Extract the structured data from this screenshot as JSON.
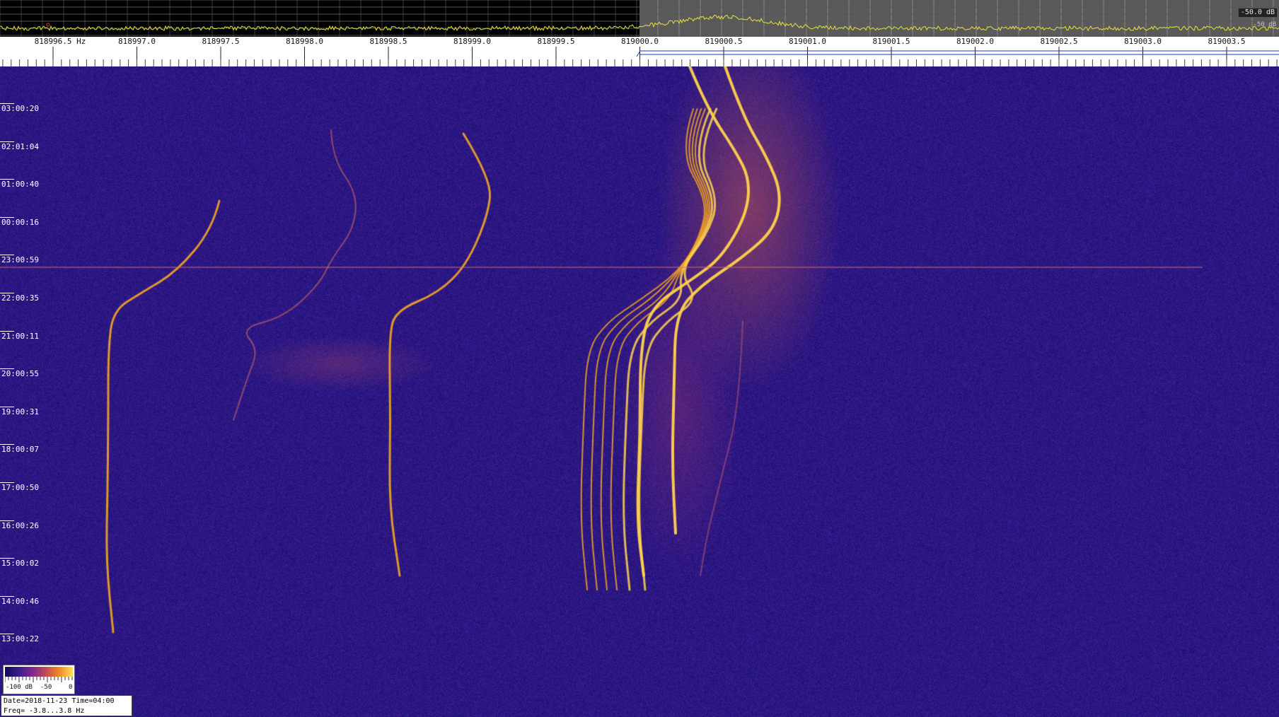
{
  "spectrum": {
    "db_label": "-50.0 dB",
    "db_label_secondary": "-50 dB",
    "trace_color": "#e6e63a",
    "marker_color": "#ff3030"
  },
  "ruler": {
    "freq_labels": [
      "818996.5 Hz",
      "818997.0",
      "818997.5",
      "818998.0",
      "818998.5",
      "818999.0",
      "818999.5",
      "819000.0",
      "819000.5",
      "819001.0",
      "819001.5",
      "819002.0",
      "819002.5",
      "819003.0",
      "819003.5"
    ]
  },
  "waterfall": {
    "time_labels": [
      "03:00:20",
      "02:01:04",
      "01:00:40",
      "00:00:16",
      "23:00:59",
      "22:00:35",
      "21:00:11",
      "20:00:55",
      "19:00:31",
      "18:00:07",
      "17:00:50",
      "16:00:26",
      "15:00:02",
      "14:00:46",
      "13:00:22"
    ],
    "colors": {
      "background": "#1c1680",
      "trace": "#f5a623",
      "trace_bright": "#ffd34d",
      "halo": "#8a3a7a"
    }
  },
  "legend": {
    "min_label": "-100 dB",
    "mid_label": "-50",
    "max_label": "0"
  },
  "info": {
    "date_time": "Date=2018-11-23 Time=04:00",
    "freq_range": "Freq= -3.8...3.8 Hz"
  }
}
